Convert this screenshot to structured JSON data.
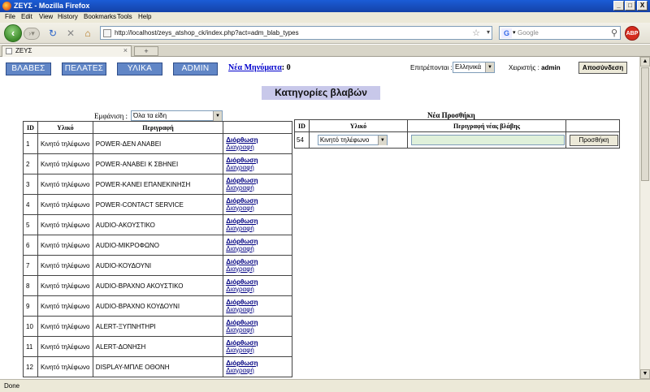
{
  "window": {
    "title": "ΖΕΥΣ - Mozilla Firefox",
    "min": "_",
    "max": "□",
    "close": "X"
  },
  "menu": [
    "File",
    "Edit",
    "View",
    "History",
    "Bookmarks",
    "Tools",
    "Help"
  ],
  "nav": {
    "url": "http://localhost/zeys_atshop_ck/index.php?act=adm_blab_types",
    "search_placeholder": "Google",
    "search_engine": "G",
    "abp": "ABP"
  },
  "tab": {
    "label": "ΖΕΥΣ",
    "newtab": "+"
  },
  "app_nav": {
    "buttons": [
      "ΒΛΑΒΕΣ",
      "ΠΕΛΑΤΕΣ",
      "ΥΛΙΚΑ",
      "ADMIN"
    ],
    "messages_label": "Νέα Μηνύματα",
    "messages_count": ": 0",
    "lang_label": "Επιτρέπονται :",
    "lang_value": "Ελληνικά",
    "user_label": "Χειριστής :",
    "user_name": "admin",
    "logout": "Αποσύνδεση"
  },
  "page_title": "Κατηγορίες βλαβών",
  "filter": {
    "label": "Εμφάνιση :",
    "value": "Όλα τα είδη"
  },
  "list": {
    "headers": [
      "ID",
      "Υλικό",
      "Περιγραφή",
      ""
    ],
    "edit_label": "Διόρθωση",
    "delete_label": "Διαγραφή",
    "rows": [
      {
        "id": "1",
        "material": "Κινητό τηλέφωνο",
        "desc": "POWER-ΔΕΝ ΑΝΑΒΕΙ"
      },
      {
        "id": "2",
        "material": "Κινητό τηλέφωνο",
        "desc": "POWER-ΑΝΑΒΕΙ Κ ΣΒΗΝΕΙ"
      },
      {
        "id": "3",
        "material": "Κινητό τηλέφωνο",
        "desc": "POWER-ΚΑΝΕΙ ΕΠΑΝΕΚΙΝΗΣΗ"
      },
      {
        "id": "4",
        "material": "Κινητό τηλέφωνο",
        "desc": "POWER-CONTACT SERVICE"
      },
      {
        "id": "5",
        "material": "Κινητό τηλέφωνο",
        "desc": "AUDIO-ΑΚΟΥΣΤΙΚΟ"
      },
      {
        "id": "6",
        "material": "Κινητό τηλέφωνο",
        "desc": "AUDIO-ΜΙΚΡΟΦΩΝΟ"
      },
      {
        "id": "7",
        "material": "Κινητό τηλέφωνο",
        "desc": "AUDIO-ΚΟΥΔΟΥΝΙ"
      },
      {
        "id": "8",
        "material": "Κινητό τηλέφωνο",
        "desc": "AUDIO-ΒΡΑΧΝΟ ΑΚΟΥΣΤΙΚΟ"
      },
      {
        "id": "9",
        "material": "Κινητό τηλέφωνο",
        "desc": "AUDIO-ΒΡΑΧΝΟ ΚΟΥΔΟΥΝΙ"
      },
      {
        "id": "10",
        "material": "Κινητό τηλέφωνο",
        "desc": "ALERT-ΞΥΠΝΗΤΗΡΙ"
      },
      {
        "id": "11",
        "material": "Κινητό τηλέφωνο",
        "desc": "ALERT-ΔΟΝΗΣΗ"
      },
      {
        "id": "12",
        "material": "Κινητό τηλέφωνο",
        "desc": "DISPLAY-ΜΠΛΕ ΟΘΟΝΗ"
      }
    ]
  },
  "new_entry": {
    "title": "Νέα Προσθήκη",
    "headers": [
      "ID",
      "Υλικό",
      "Περιγραφή νέας βλάβης",
      ""
    ],
    "id": "54",
    "material": "Κινητό τηλέφωνο",
    "description": "",
    "add_label": "Προσθήκη"
  },
  "status": "Done",
  "colors": {
    "app_button": "#6186c6",
    "heading_bg": "#c8c8ea",
    "input_bg": "#dff0da",
    "link": "#000080"
  }
}
